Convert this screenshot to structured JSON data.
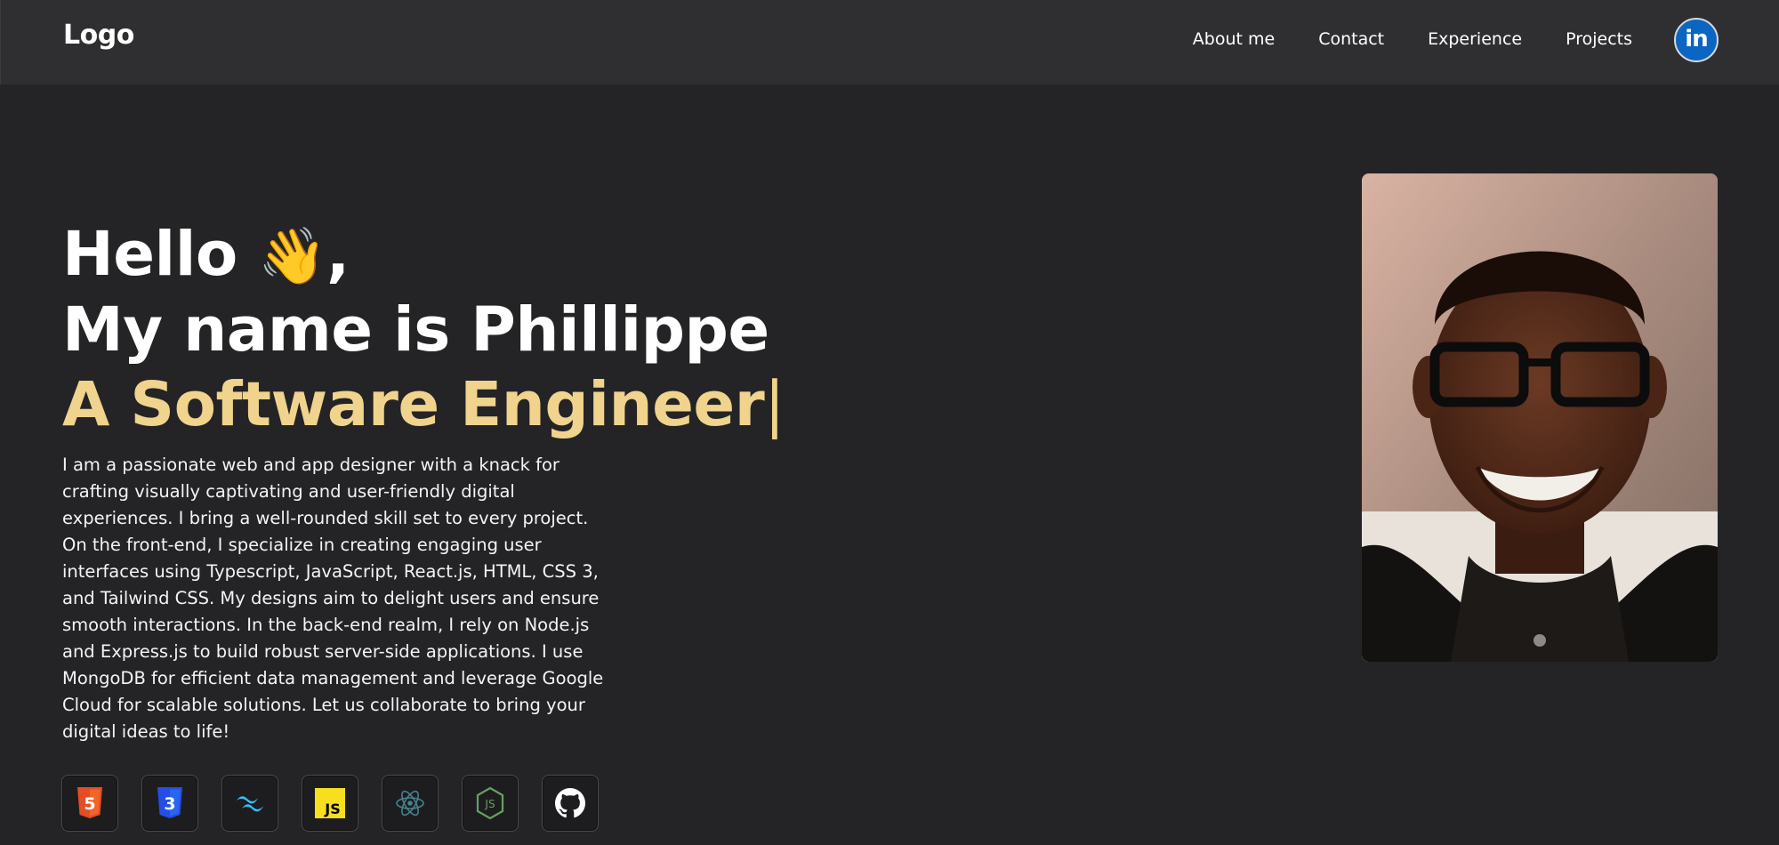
{
  "header": {
    "logo": "Logo",
    "nav": [
      "About me",
      "Contact",
      "Experience",
      "Projects"
    ],
    "social_icon": "linkedin-icon"
  },
  "hero": {
    "greeting": "Hello",
    "greeting_emoji": "👋",
    "greeting_suffix": ",",
    "name_line": "My name is Phillippe",
    "role": "A Software Engineer",
    "cursor": "|",
    "bio": "I am a passionate web and app designer with a knack for crafting visually captivating and user-friendly digital experiences. I bring a well-rounded skill set to every project. On the front-end, I specialize in creating engaging user interfaces using Typescript, JavaScript, React.js, HTML, CSS 3, and Tailwind CSS. My designs aim to delight users and ensure smooth interactions. In the back-end realm, I rely on Node.js and Express.js to build robust server-side applications. I use MongoDB for efficient data management and leverage Google Cloud for scalable solutions. Let us collaborate to bring your digital ideas to life!"
  },
  "skills": [
    {
      "icon": "html5-icon",
      "glyph": "5",
      "color": "#e44d26"
    },
    {
      "icon": "css3-icon",
      "glyph": "3",
      "color": "#264de4"
    },
    {
      "icon": "tailwind-icon",
      "glyph": "~",
      "color": "#38bdf8"
    },
    {
      "icon": "javascript-icon",
      "glyph": "JS",
      "color": "#f7df1e"
    },
    {
      "icon": "electron-icon",
      "glyph": "⚛",
      "color": "#47848f"
    },
    {
      "icon": "nodejs-icon",
      "glyph": "JS",
      "color": "#68a063"
    },
    {
      "icon": "github-icon",
      "glyph": "",
      "color": "#ffffff"
    }
  ],
  "colors": {
    "background": "#242426",
    "header": "#2f2f31",
    "accent": "#f0d38c",
    "linkedin": "#0a66c2"
  }
}
